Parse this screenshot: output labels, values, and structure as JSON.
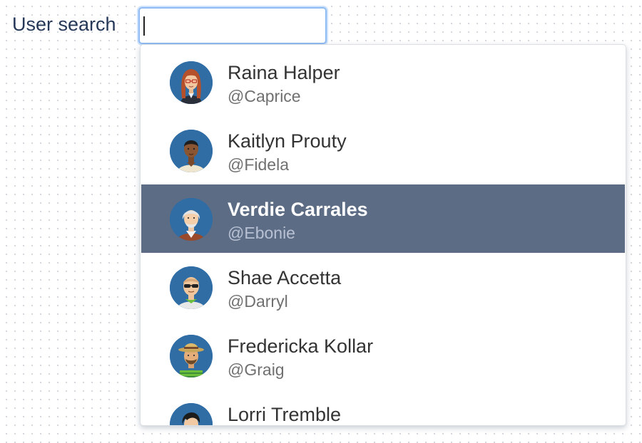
{
  "search": {
    "label": "User search",
    "value": "",
    "placeholder": ""
  },
  "colors": {
    "selected_row": "#5d6c85",
    "focus_border": "#8ebcf2",
    "avatar_bg": "#2f6da4"
  },
  "users": [
    {
      "name": "Raina Halper",
      "handle": "@Caprice",
      "avatar": "woman-red-hair-glasses-avatar",
      "selected": false
    },
    {
      "name": "Kaitlyn Prouty",
      "handle": "@Fidela",
      "avatar": "man-dark-skin-avatar",
      "selected": false
    },
    {
      "name": "Verdie Carrales",
      "handle": "@Ebonie",
      "avatar": "elderly-man-gray-hair-avatar",
      "selected": true
    },
    {
      "name": "Shae Accetta",
      "handle": "@Darryl",
      "avatar": "man-sunglasses-avatar",
      "selected": false
    },
    {
      "name": "Fredericka Kollar",
      "handle": "@Graig",
      "avatar": "man-straw-hat-avatar",
      "selected": false
    },
    {
      "name": "Lorri Tremble",
      "handle": "",
      "avatar": "person-black-hair-avatar",
      "selected": false
    }
  ]
}
